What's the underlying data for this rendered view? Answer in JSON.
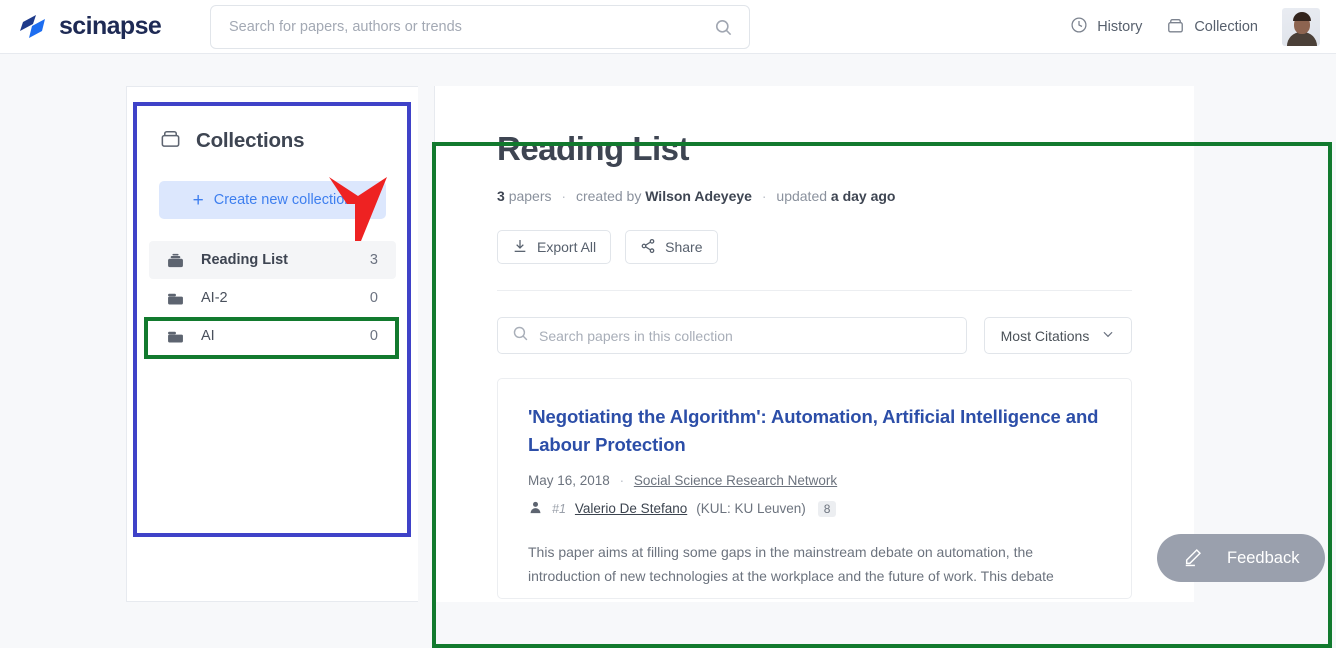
{
  "header": {
    "logo_text": "scinapse",
    "search": {
      "value": "",
      "placeholder": "Search for papers, authors or trends"
    },
    "history_label": "History",
    "collection_label": "Collection"
  },
  "sidebar": {
    "title": "Collections",
    "create_label": "Create new collection",
    "items": [
      {
        "label": "Reading List",
        "count": "3",
        "active": true
      },
      {
        "label": "AI-2",
        "count": "0",
        "active": false
      },
      {
        "label": "AI",
        "count": "0",
        "active": false
      }
    ]
  },
  "main": {
    "title": "Reading List",
    "meta": {
      "papers_count": "3",
      "papers_word": "papers",
      "created_by_label": "created by",
      "creator": "Wilson Adeyeye",
      "updated_label": "updated",
      "updated_value": "a day ago",
      "separator": "·"
    },
    "export_label": "Export All",
    "share_label": "Share",
    "collection_search": {
      "value": "",
      "placeholder": "Search papers in this collection"
    },
    "sort": {
      "selected": "Most Citations"
    },
    "papers": [
      {
        "title": "'Negotiating the Algorithm': Automation, Artificial Intelligence and Labour Protection",
        "date": "May 16, 2018",
        "venue": "Social Science Research Network",
        "rank": "#1",
        "author": "Valerio De Stefano",
        "affiliation": "(KUL: KU Leuven)",
        "author_citations": "8",
        "abstract": "This paper aims at filling some gaps in the mainstream debate on automation, the introduction of new technologies at the workplace and the future of work. This debate"
      }
    ]
  },
  "feedback": {
    "label": "Feedback"
  },
  "colors": {
    "brand_blue": "#2c4ea8",
    "accent_blue": "#3e7fef",
    "annotation_blue": "#3f42c8",
    "annotation_green": "#127a2e",
    "annotation_red": "#ee2222"
  }
}
